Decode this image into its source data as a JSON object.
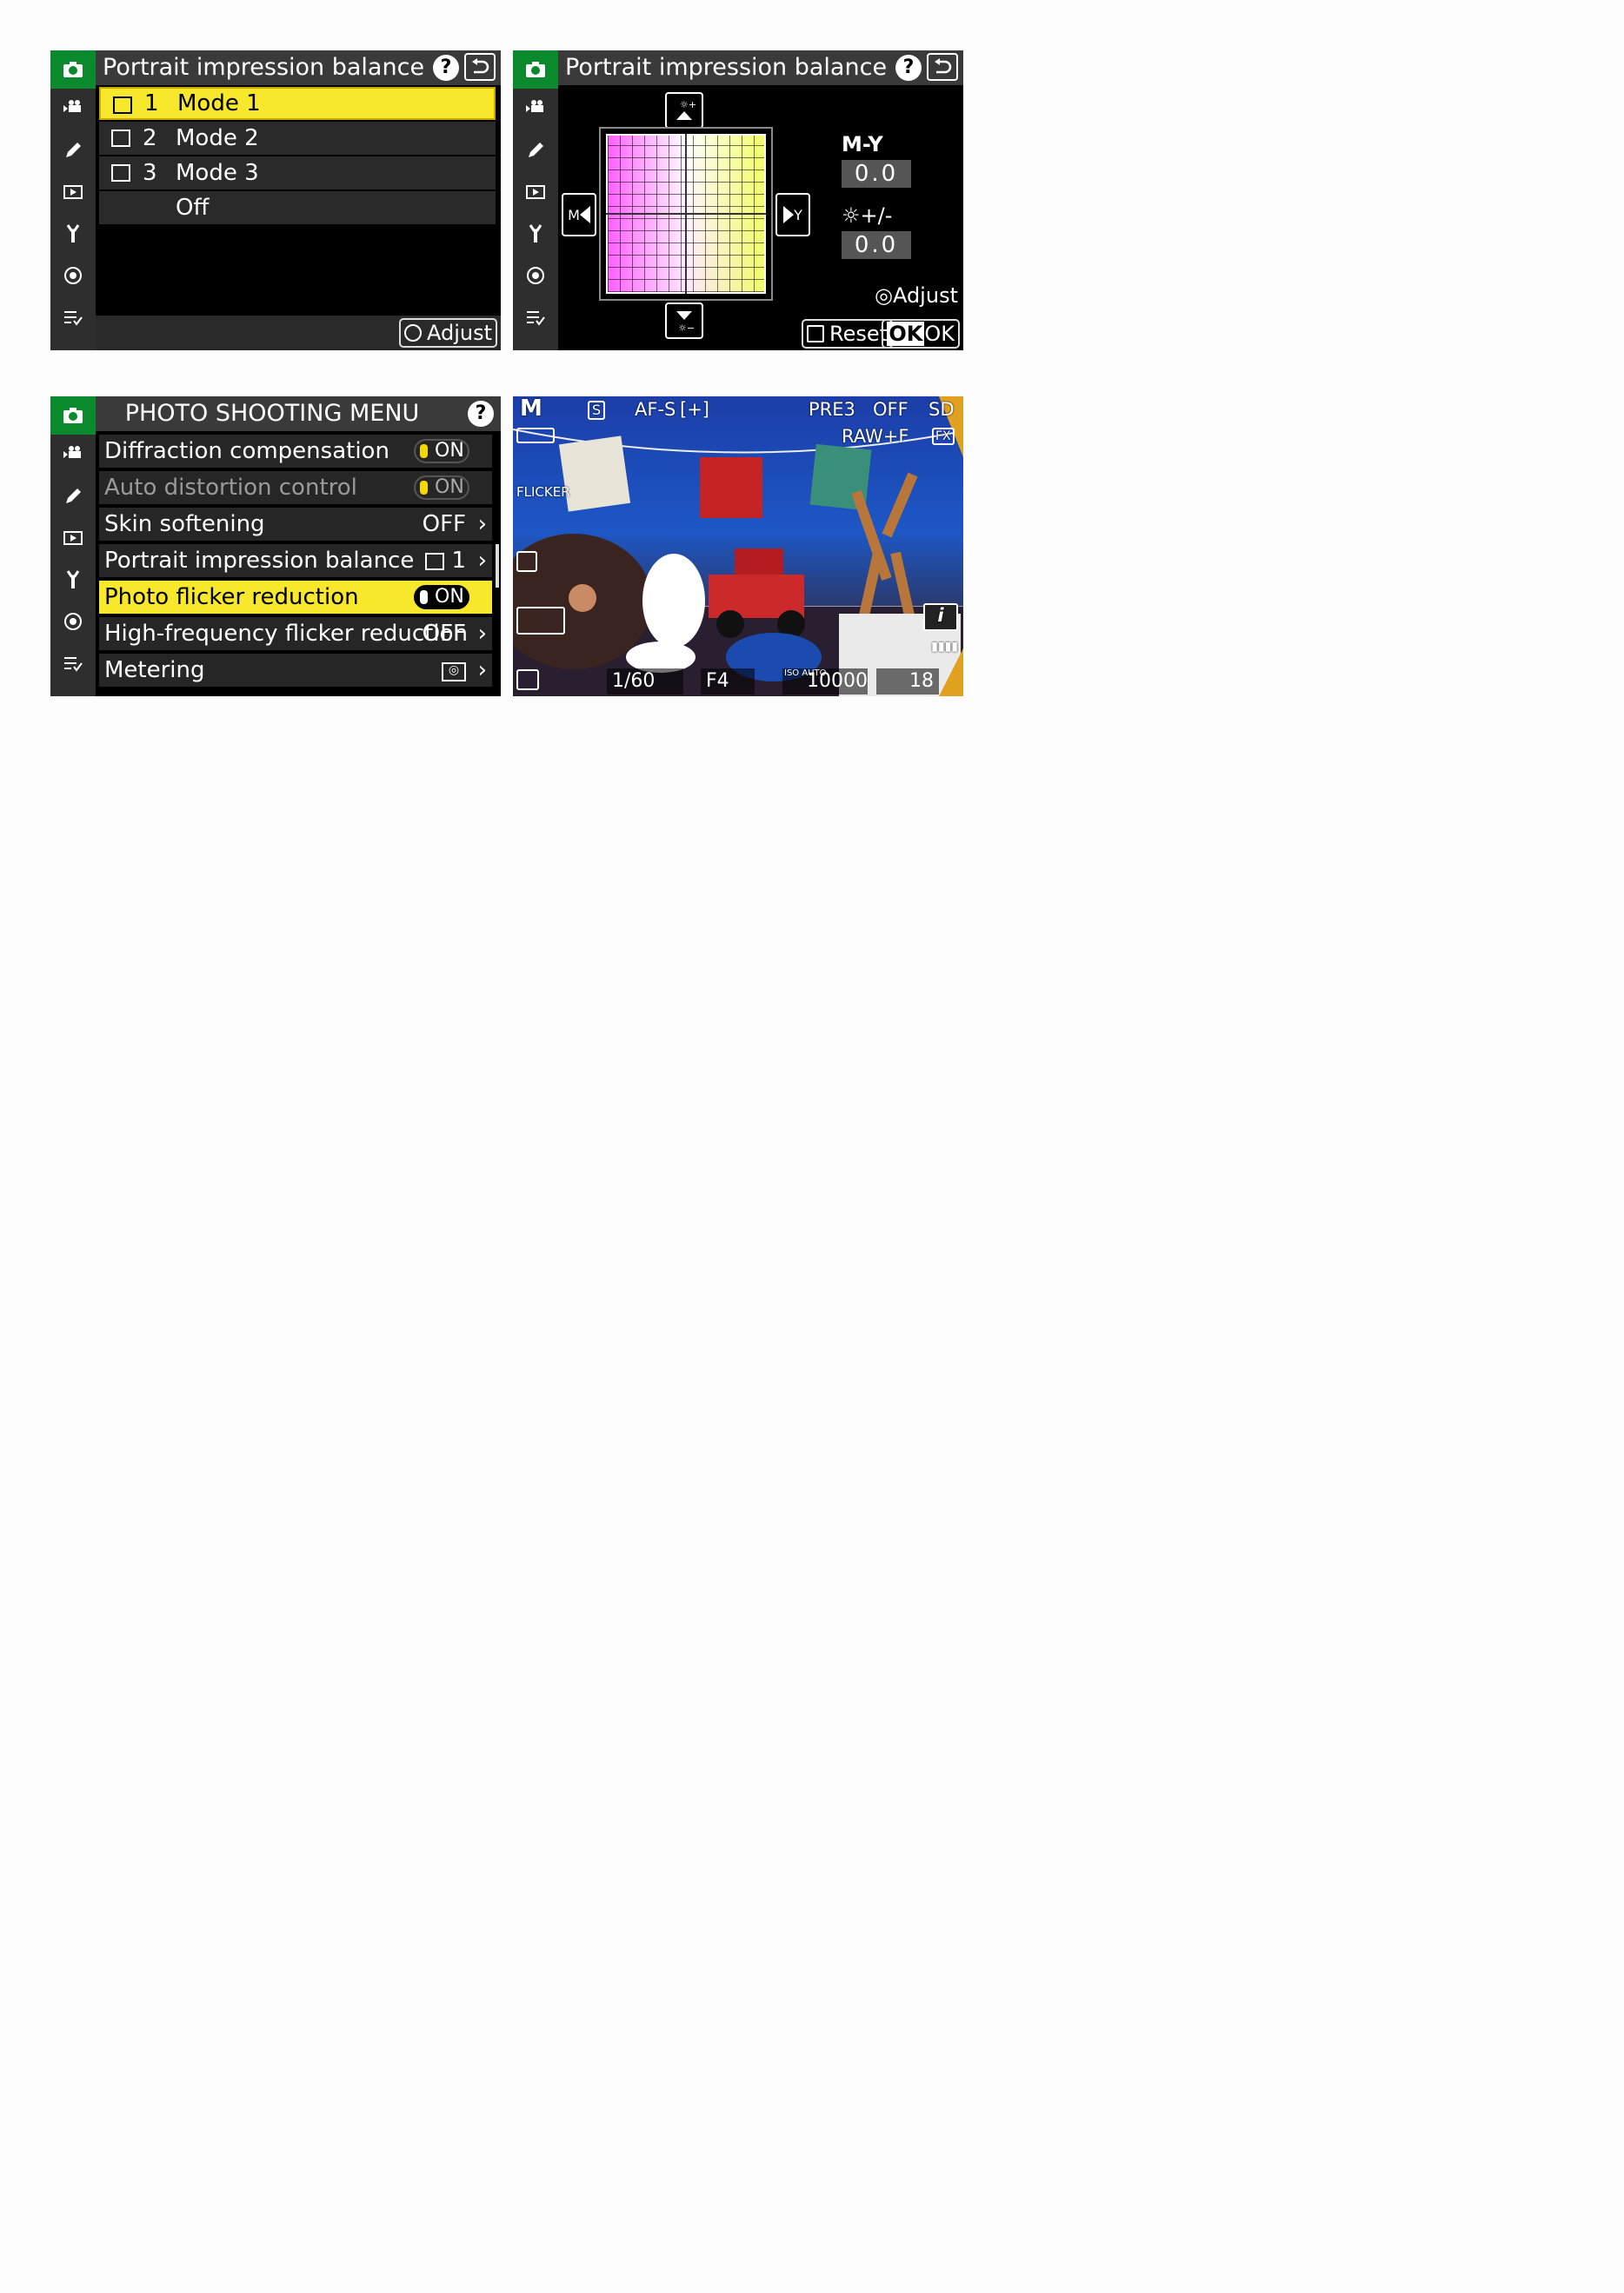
{
  "panel1": {
    "title": "Portrait impression balance",
    "help": "?",
    "items": [
      {
        "num": "1",
        "label": "Mode 1"
      },
      {
        "num": "2",
        "label": "Mode 2"
      },
      {
        "num": "3",
        "label": "Mode 3"
      },
      {
        "num": "",
        "label": "Off"
      }
    ],
    "footer_adjust": "Adjust"
  },
  "panel2": {
    "title": "Portrait impression balance",
    "help": "?",
    "m_y_label": "M-Y",
    "m_y_value": "0.0",
    "brightness_label": "+/-",
    "brightness_value": "0.0",
    "left_arrow": "M",
    "right_arrow": "Y",
    "adjust": "Adjust",
    "reset": "Reset",
    "ok": "OK",
    "ok_key": "OK"
  },
  "panel3": {
    "title": "PHOTO SHOOTING MENU",
    "help": "?",
    "rows": [
      {
        "label": "Diffraction compensation",
        "value": "ON"
      },
      {
        "label": "Auto distortion control",
        "value": "ON"
      },
      {
        "label": "Skin softening",
        "value": "OFF"
      },
      {
        "label": "Portrait impression balance",
        "value": "1"
      },
      {
        "label": "Photo flicker reduction",
        "value": "ON"
      },
      {
        "label": "High-frequency flicker reduction",
        "value": "OFF"
      },
      {
        "label": "Metering",
        "value": ""
      }
    ]
  },
  "panel4": {
    "mode": "M",
    "s": "S",
    "af": "AF-S",
    "pre": "PRE3",
    "off": "OFF",
    "sd": "SD",
    "raw": "RAW+F",
    "fx": "FX",
    "flicker": "FLICKER",
    "shutter": "1/60",
    "aperture": "F4",
    "iso_label": "ISO AUTO",
    "iso": "10000",
    "frames": "18"
  }
}
